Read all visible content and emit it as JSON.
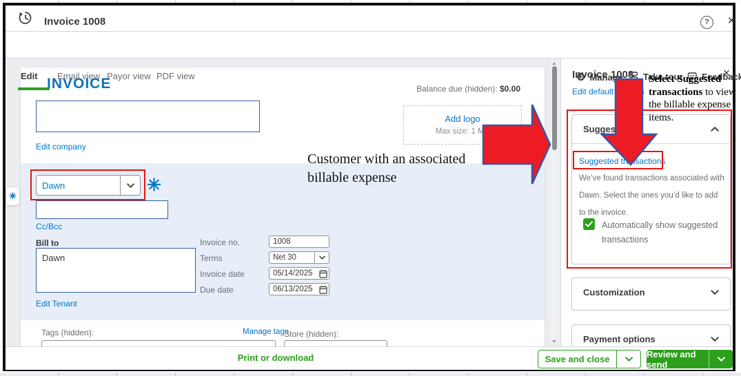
{
  "window": {
    "title": "Invoice 1008",
    "icons": {
      "help": "?",
      "close": "×",
      "gear": "⚙",
      "sparkle": "✳"
    }
  },
  "tabs": {
    "items": [
      "Edit",
      "Email view",
      "Payor view",
      "PDF view"
    ],
    "active": "Edit"
  },
  "topbar_actions": {
    "manage": "Manage",
    "take_tour": "Take tour",
    "feedback": "Feedback"
  },
  "invoice_form": {
    "heading": "INVOICE",
    "balance_label": "Balance due (hidden): ",
    "balance_value": "$0.00",
    "add_logo_label": "Add logo",
    "add_logo_note": "Max size: 1 MB",
    "edit_company_link": "Edit company",
    "customer_value": "Dawn",
    "email_value": "",
    "ccbcc_link": "Cc/Bcc",
    "bill_to_label": "Bill to",
    "bill_to_value": "Dawn",
    "edit_tenant_link": "Edit Tenant",
    "fields": {
      "invoice_no": {
        "label": "Invoice no.",
        "value": "1008"
      },
      "terms": {
        "label": "Terms",
        "value": "Net 30"
      },
      "invoice_date": {
        "label": "Invoice date",
        "value": "05/14/2025"
      },
      "due_date": {
        "label": "Due date",
        "value": "06/13/2025"
      }
    },
    "tags_label": "Tags (hidden):",
    "manage_tags_link": "Manage tags",
    "store_label": "Store (hidden):",
    "tags_value": "",
    "store_value": ""
  },
  "footer": {
    "print_link": "Print or download",
    "save_button": "Save and close",
    "review_button": "Review and send"
  },
  "panel": {
    "title": "Invoice 1008",
    "edit_default_link": "Edit default settings",
    "suggestions": {
      "header": "Suggestions",
      "link": "Suggested transactions",
      "body": "We’ve found transactions associated with Dawn. Select the ones you’d like to add to the invoice.",
      "checkbox_label": "Automatically show suggested transactions",
      "checkbox_checked": true
    },
    "customization_header": "Customization",
    "payment_options_header": "Payment options"
  },
  "annotations": {
    "callout_right_bold": "Select Suggested transactions",
    "callout_right_rest": " to view the billable expense items.",
    "callout_main": "Customer with an associated billable expense"
  },
  "colors": {
    "accent_green": "#2ca01c",
    "link_blue": "#0077c5",
    "invoice_blue": "#0d72b9",
    "section_blue": "#e7eef8",
    "annotation_red": "#e8120c",
    "arrow_fill": "#ed1c24",
    "arrow_stroke": "#3a53a4"
  }
}
